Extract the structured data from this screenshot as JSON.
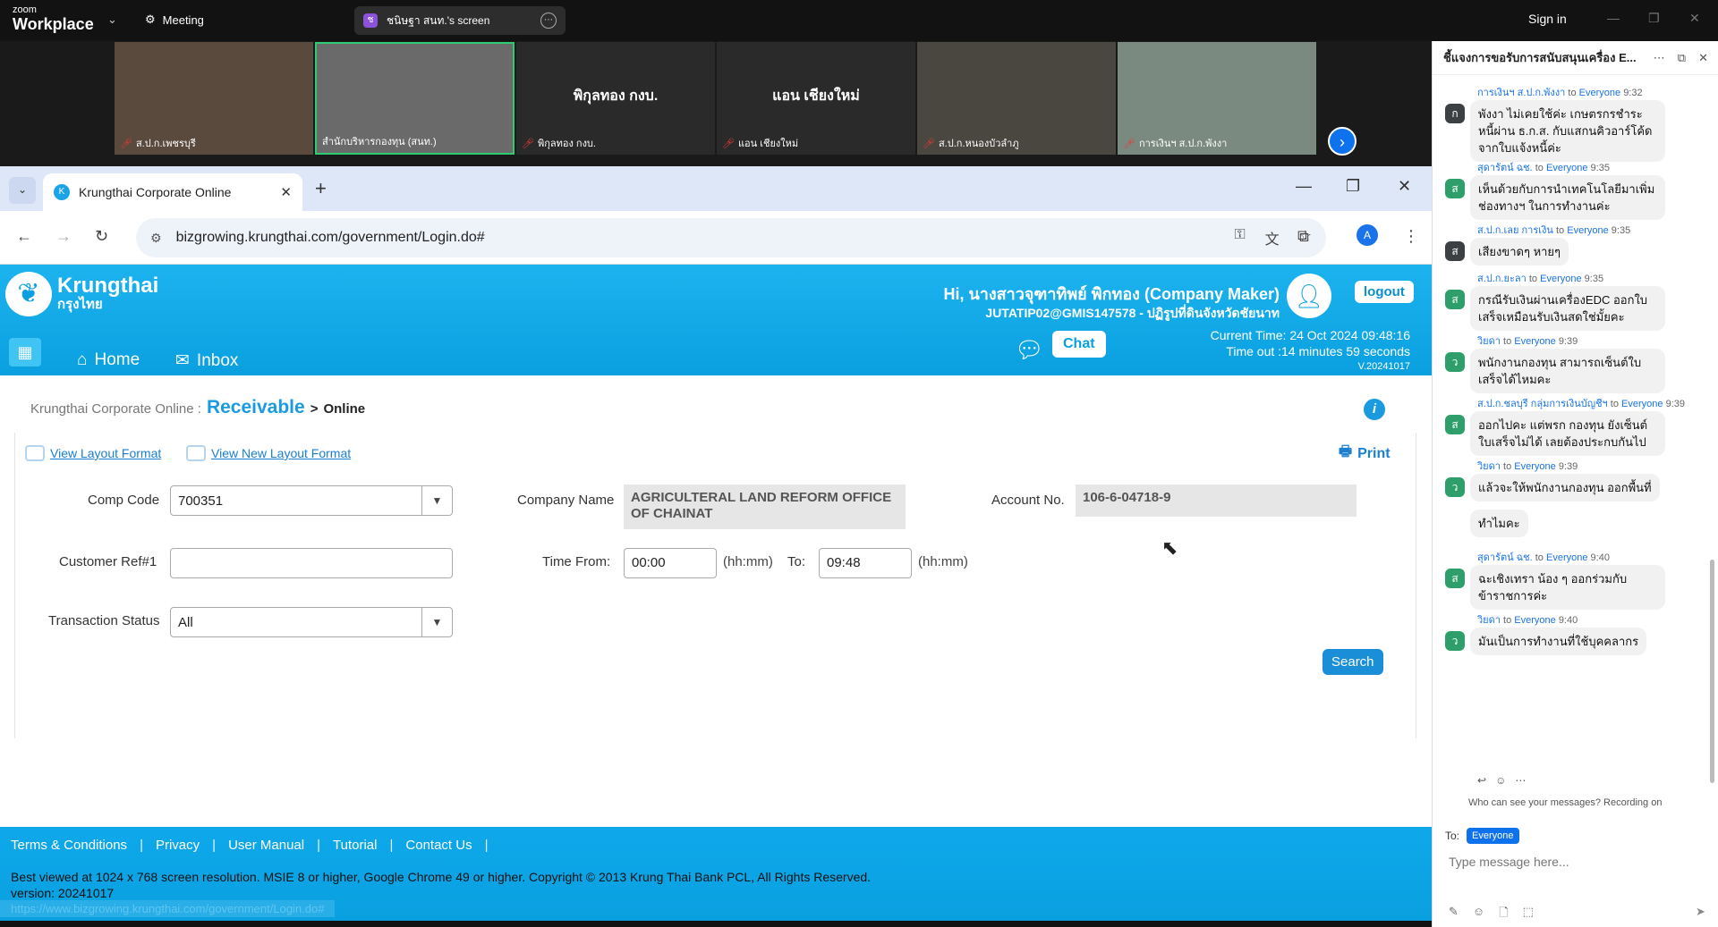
{
  "zoom": {
    "logo_small": "zoom",
    "logo_big": "Workplace",
    "meeting_label": "Meeting",
    "share_label": "ชนิษฐา สนท.'s screen",
    "signin": "Sign in"
  },
  "gallery": {
    "tiles": [
      {
        "name": "ส.ป.ก.เพชรบุรี"
      },
      {
        "name": "สำนักบริหารกองทุน (สนท.)"
      },
      {
        "name": "พิกุลทอง กงบ.",
        "center": "พิกุลทอง กงบ."
      },
      {
        "name": "แอน เชียงใหม่",
        "center": "แอน เชียงใหม่"
      },
      {
        "name": "ส.ป.ก.หนองบัวลำภู"
      },
      {
        "name": "การเงินฯ ส.ป.ก.พังงา"
      }
    ]
  },
  "browser": {
    "tab_title": "Krungthai Corporate Online",
    "url": "bizgrowing.krungthai.com/government/Login.do#",
    "profile_initial": "A"
  },
  "header": {
    "brand_en": "Krungthai",
    "brand_th": "กรุงไทย",
    "greeting": "Hi, นางสาวจุฑาทิพย์ พิกทอง (Company Maker)",
    "email": "JUTATIP02@GMIS147578 - ปฏิรูปที่ดินจังหวัดชัยนาท",
    "logout": "logout",
    "chat": "Chat",
    "current_time": "Current Time: 24 Oct 2024 09:48:16",
    "timeout": "Time out :14 minutes 59 seconds",
    "version": "V.20241017",
    "nav_home": "Home",
    "nav_inbox": "Inbox"
  },
  "breadcrumb": {
    "root": "Krungthai Corporate Online :",
    "section": "Receivable",
    "sep": ">",
    "page": "Online"
  },
  "links": {
    "layout": "View Layout Format",
    "new_layout": "View New Layout Format",
    "print": "Print"
  },
  "form": {
    "comp_code_label": "Comp Code",
    "comp_code_value": "700351",
    "company_name_label": "Company Name",
    "company_name_value": "AGRICULTERAL LAND REFORM OFFICE OF CHAINAT",
    "account_label": "Account No.",
    "account_value": "106-6-04718-9",
    "custref_label": "Customer Ref#1",
    "custref_value": "",
    "time_from_label": "Time From:",
    "time_from_value": "00:00",
    "hhmm1": "(hh:mm)",
    "to_label": "To:",
    "to_value": "09:48",
    "hhmm2": "(hh:mm)",
    "status_label": "Transaction Status",
    "status_value": "All",
    "search": "Search"
  },
  "footer": {
    "links": [
      "Terms & Conditions",
      "Privacy",
      "User Manual",
      "Tutorial",
      "Contact Us"
    ],
    "copyright": "Best viewed at 1024 x 768 screen resolution. MSIE 8 or higher, Google Chrome 49 or higher. Copyright © 2013 Krung Thai Bank PCL, All Rights Reserved.",
    "version": "version: 20241017",
    "status_url": "https://www.bizgrowing.krungthai.com/government/Login.do#"
  },
  "chat": {
    "title": "ชี้แจงการขอรับการสนับสนุนเครื่อง E...",
    "messages": [
      {
        "sender": "การเงินฯ ส.ป.ก.พังงา",
        "to": "to",
        "audience": "Everyone",
        "time": "9:32",
        "avatar": "ก",
        "color": "#3c4043",
        "text": "พังงา ไม่เคยใช้ค่ะ เกษตรกรชำระหนี้ผ่าน ธ.ก.ส. กับแสกนคิวอาร์โค้ดจากใบแจ้งหนี้ค่ะ"
      },
      {
        "sender": "สุดารัตน์ ฉช.",
        "to": "to",
        "audience": "Everyone",
        "time": "9:35",
        "avatar": "ส",
        "color": "#2e9e6a",
        "text": "เห็นด้วยกับการนำเทคโนโลยีมาเพิ่มช่องทางฯ ในการทำงานค่ะ"
      },
      {
        "sender": "ส.ป.ก.เลย การเงิน",
        "to": "to",
        "audience": "Everyone",
        "time": "9:35",
        "avatar": "ส",
        "color": "#3c4043",
        "text": "เสียงขาดๆ หายๆ"
      },
      {
        "sender": "ส.ป.ก.ยะลา",
        "to": "to",
        "audience": "Everyone",
        "time": "9:35",
        "avatar": "ส",
        "color": "#2e9e6a",
        "text": "กรณีรับเงินผ่านเครื่องEDC ออกใบเสร็จเหมือนรับเงินสดใช่มั้ยคะ"
      },
      {
        "sender": "วิยดา",
        "to": "to",
        "audience": "Everyone",
        "time": "9:39",
        "avatar": "ว",
        "color": "#2e9e6a",
        "text": "พนักงานกองทุน สามารถเซ็นต์ใบเสร็จได้ไหมคะ"
      },
      {
        "sender": "ส.ป.ก.ชลบุรี กลุ่มการเงินบัญชีฯ",
        "to": "to",
        "audience": "Everyone",
        "time": "9:39",
        "avatar": "ส",
        "color": "#2e9e6a",
        "text": "ออกไปคะ แต่พรก กองทุน ยังเซ็นต์ใบเสร็จไม่ได้ เลยต้องประกบกันไป"
      },
      {
        "sender": "วิยดา",
        "to": "to",
        "audience": "Everyone",
        "time": "9:39",
        "avatar": "ว",
        "color": "#2e9e6a",
        "text": "แล้วจะให้พนักงานกองทุน ออกพื้นที่"
      },
      {
        "sender": "",
        "to": "",
        "audience": "",
        "time": "",
        "avatar": "",
        "color": "",
        "text": "ทำไมคะ"
      },
      {
        "sender": "สุดารัตน์ ฉช.",
        "to": "to",
        "audience": "Everyone",
        "time": "9:40",
        "avatar": "ส",
        "color": "#2e9e6a",
        "text": "ฉะเชิงเทรา น้อง ๆ ออกร่วมกับข้าราชการค่ะ"
      },
      {
        "sender": "วิยดา",
        "to": "to",
        "audience": "Everyone",
        "time": "9:40",
        "avatar": "ว",
        "color": "#2e9e6a",
        "text": "มันเป็นการทำงานที่ใช้บุคคลากร"
      }
    ],
    "privacy_note": "Who can see your messages? Recording on",
    "to_label": "To:",
    "to_value": "Everyone",
    "placeholder": "Type message here..."
  }
}
